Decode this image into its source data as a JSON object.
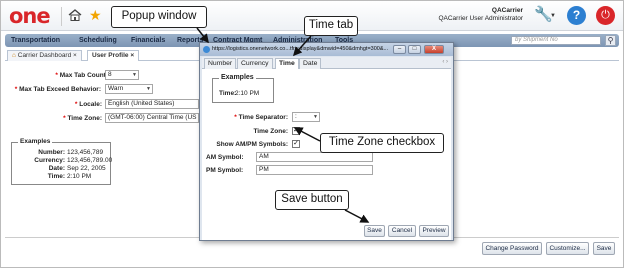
{
  "header": {
    "logo": "one",
    "user_name": "QACarrier",
    "user_role": "QACarrier User Administrator",
    "icons": [
      "home-icon",
      "star-icon",
      "wrench-icon",
      "help-icon",
      "power-icon"
    ]
  },
  "nav": {
    "items": [
      "Transportation",
      "Scheduling",
      "Financials",
      "Reports",
      "Contract Mgmt",
      "Administration",
      "Tools"
    ],
    "search_placeholder": "by Shipment No"
  },
  "page_tabs": [
    {
      "label": "Carrier Dashboard",
      "close": "×"
    },
    {
      "label": "User Profile",
      "close": "×"
    }
  ],
  "form": {
    "max_tab_count": {
      "label": "Max Tab Count:",
      "value": "8"
    },
    "max_tab_exceed": {
      "label": "Max Tab Exceed Behavior:",
      "value": "Warn"
    },
    "locale": {
      "label": "Locale:",
      "value": "English (United States)"
    },
    "time_zone": {
      "label": "Time Zone:",
      "value": "(GMT-06:00) Central Time (US"
    }
  },
  "examples": {
    "legend": "Examples",
    "number_label": "Number:",
    "number_value": "123,456,789",
    "currency_label": "Currency:",
    "currency_value": "123,456,789.00",
    "date_label": "Date:",
    "date_value": "Sep 22, 2005",
    "time_label": "Time:",
    "time_value": "2:10 PM"
  },
  "bottom_buttons": {
    "change_password": "Change Password",
    "customize": "Customize...",
    "save": "Save"
  },
  "popup": {
    "url": "https://logistics.onenetwork.co...tfrn:display&dmwid=450&dmhgt=300&...",
    "win_min": "–",
    "win_max": "□",
    "win_close": "X",
    "tabs": [
      "Number",
      "Currency",
      "Time",
      "Date"
    ],
    "active_tab": "Time",
    "scroll": "‹ ›",
    "examples_legend": "Examples",
    "example_time_label": "Time:",
    "example_time_value": "2:10 PM",
    "time_separator_label": "Time Separator:",
    "time_separator_value": ":",
    "time_zone_label": "Time Zone:",
    "time_zone_checked": true,
    "show_ampm_label": "Show AM/PM Symbols:",
    "show_ampm_checked": true,
    "am_symbol_label": "AM Symbol:",
    "am_symbol_value": "AM",
    "pm_symbol_label": "PM Symbol:",
    "pm_symbol_value": "PM",
    "check_mark": "✓",
    "buttons": {
      "save": "Save",
      "cancel": "Cancel",
      "preview": "Preview"
    }
  },
  "callouts": {
    "popup_window": "Popup window",
    "time_tab": "Time tab",
    "time_zone_checkbox": "Time Zone checkbox",
    "save_button": "Save button"
  },
  "colors": {
    "brand_red": "#d9262a",
    "nav_blue": "#8aa2bf",
    "help_blue": "#2c7fd1"
  }
}
